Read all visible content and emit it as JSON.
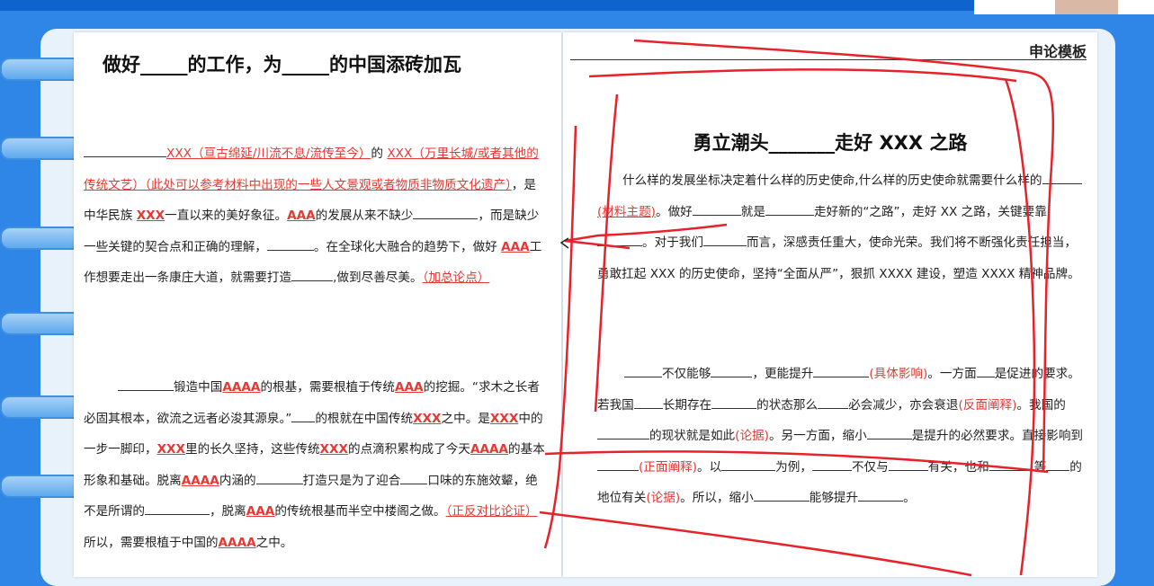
{
  "left_page": {
    "title": "做好_____的工作，为_____的中国添砖加瓦",
    "para1": {
      "p1": "XXX（亘古绵延/川流不息/流传至今）",
      "p2": "的",
      "p3": "XXX（万里长城/或者其他的传统文艺）（此处可以参考材料中出现的一些人文景观或者物质非物质文化遗产）",
      "p4": "，是中华民族",
      "p5": "XXX",
      "p6": "一直以来的美好象征。",
      "p7": "AAA",
      "p8": "的发展从来不缺少",
      "p9": "，而是缺少一些关键的契合点和正确的理解，",
      "p10": "。在全球化大融合的趋势下，做好",
      "p11": "AAA",
      "p12": "工作想要走出一条康庄大道，就需要打造",
      "p13": ",做到尽善尽美。",
      "p14": "（加总论点）"
    },
    "para2": {
      "p1": "锻造中国",
      "p2": "AAAA",
      "p3": "的根基，需要根植于传统",
      "p4": "AAA",
      "p5": "的挖掘。“求木之长者必固其根本，欲流之远者必浚其源泉。”",
      "p6": "的根就在中国传统",
      "p7": "XXX",
      "p8": "之中。是",
      "p9": "XXX",
      "p10": "中的一步一脚印，",
      "p11": "XXX",
      "p12": "里的长久坚持，这些传统",
      "p13": "XXX",
      "p14": "的点滴积累构成了今天",
      "p15": "AAAA",
      "p16": "的基本形象和基础。脱离",
      "p17": "AAAA",
      "p18": "内涵的",
      "p19": "打造只是为了迎合",
      "p20": "口味的东施效颦，绝不是所谓的",
      "p21": "，脱离",
      "p22": "AAA",
      "p23": "的传统根基而半空中楼阁之做。",
      "p24": "（正反对比论证）",
      "p25": "所以，需要根植于中国的",
      "p26": "AAAA",
      "p27": "之中。"
    }
  },
  "right_page": {
    "header_label": "申论模板",
    "title": "勇立潮头_______走好 XXX 之路",
    "para1": {
      "p1": "什么样的发展坐标决定着什么样的历史使命,什么样的历史使命就需要什么样的",
      "p2": "(材料主题)",
      "p3": "。做好",
      "p4": "就是",
      "p5": "走好新的“之路”，走好 XX 之路，关键要靠",
      "p6": "。对于我们",
      "p7": "而言，深感责任重大，使命光荣。我们将不断强化责任担当，勇敢扛起 XXX 的历史使命，坚持“全面从严”，狠抓 XXXX 建设，塑造 XXXX 精神品牌。"
    },
    "para2": {
      "p1": "不仅能够",
      "p2": "，更能提升",
      "p3": "(具体影响)",
      "p4": "。一方面",
      "p5": "是促进",
      "p6": "的要求。若我国",
      "p7": "长期存在",
      "p8": "的状态那么",
      "p9": "必会减少，亦会衰退",
      "p10": "(反面阐释)",
      "p11": "。我国的",
      "p12": "的现状就是如此",
      "p13": "(论据)",
      "p14": "。另一方面，缩小",
      "p15": "是提升",
      "p16": "的必然要求。直接影响到",
      "p17": "(正面阐释)",
      "p18": "。以",
      "p19": "为例，",
      "p20": "不仅与",
      "p21": "有关，也和",
      "p22": "等",
      "p23": "的地位有关",
      "p24": "(论据)",
      "p25": "。所以，缩小",
      "p26": "能够提升",
      "p27": "。"
    }
  },
  "colors": {
    "accent_red": "#e53935",
    "background_blue": "#2f86e6",
    "ink_red": "#e8222a"
  }
}
